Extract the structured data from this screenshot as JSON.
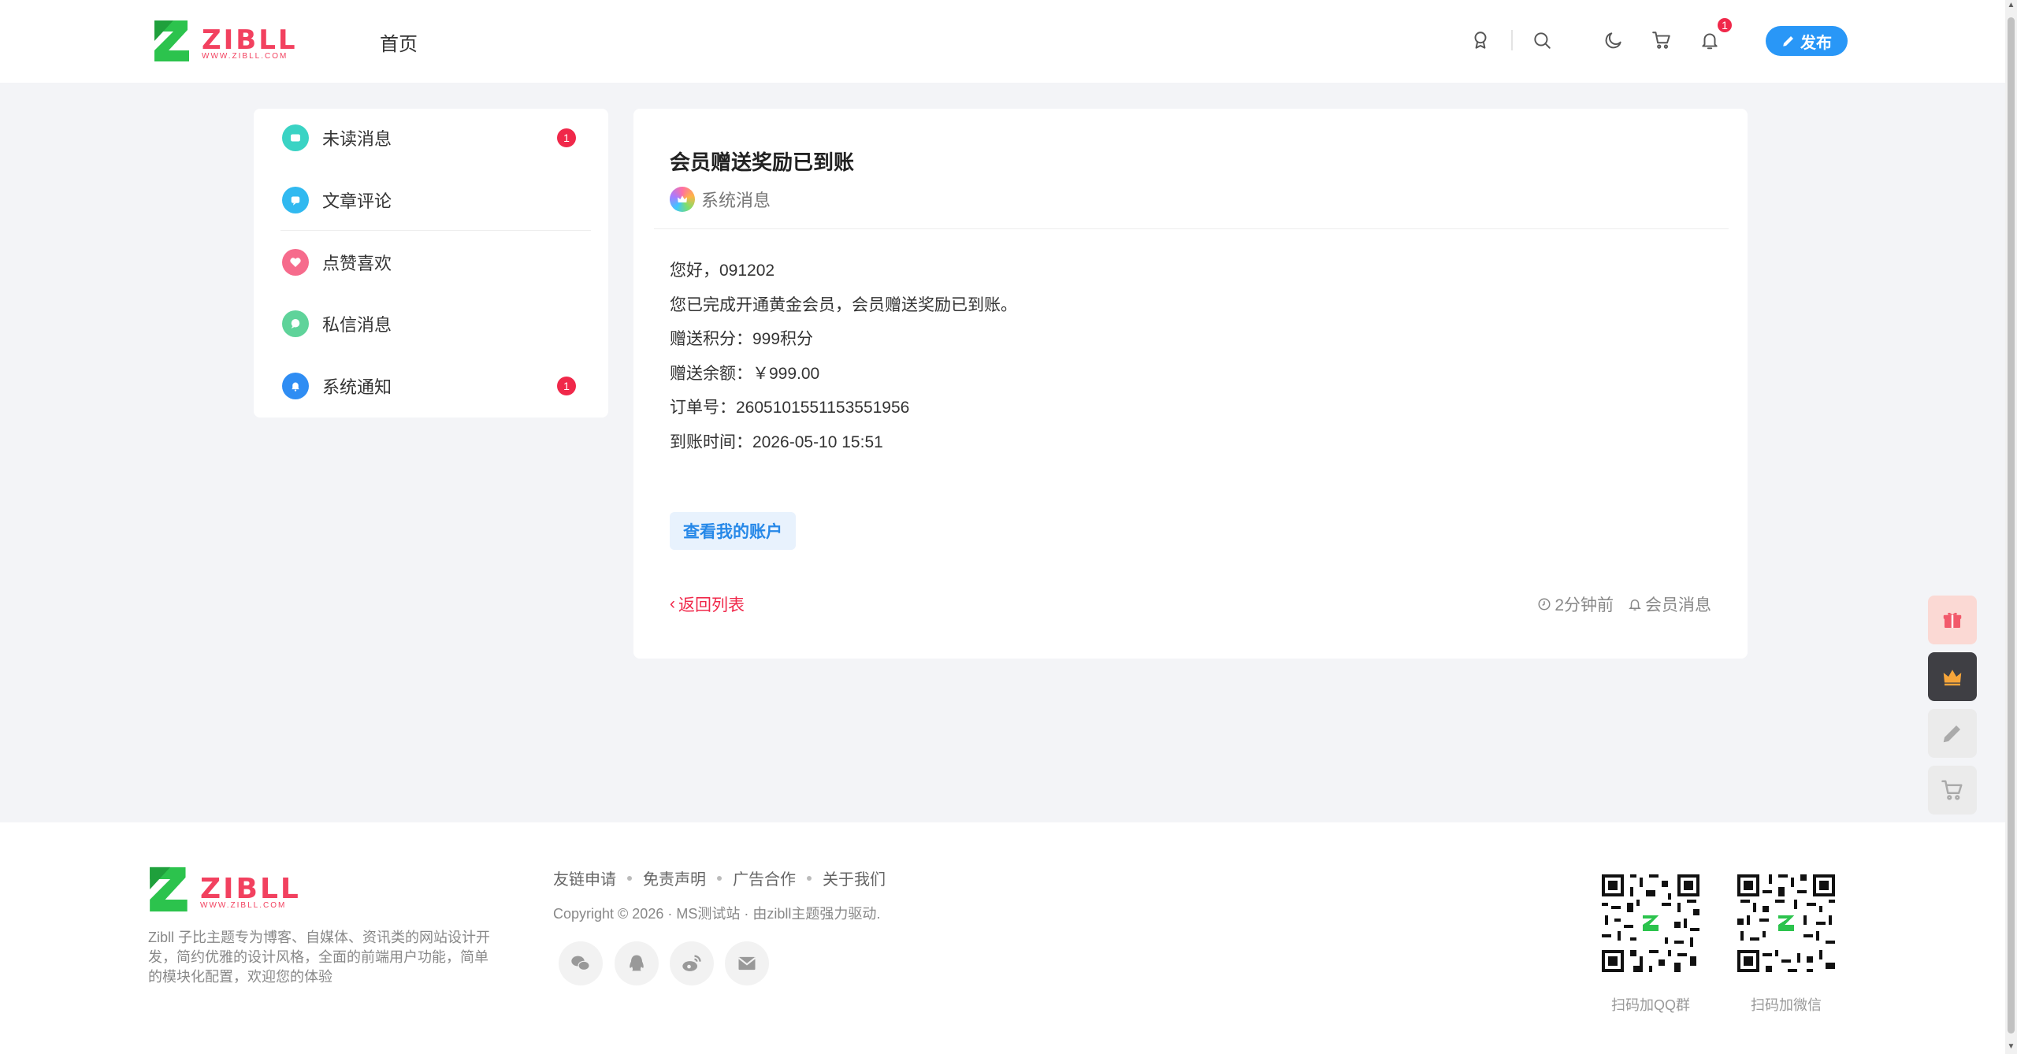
{
  "header": {
    "logo_text": "ZIBLL",
    "logo_sub": "WWW.ZIBLL.COM",
    "nav_home": "首页",
    "notification_count": "1",
    "publish_label": "发布"
  },
  "sidebar": {
    "items": [
      {
        "label": "未读消息",
        "badge": "1",
        "icon": "message-icon",
        "color": "#3ad3c4"
      },
      {
        "label": "文章评论",
        "icon": "comment-icon",
        "color": "#31b9f0"
      },
      {
        "label": "点赞喜欢",
        "icon": "heart-icon",
        "color": "#f66b8c"
      },
      {
        "label": "私信消息",
        "icon": "chat-bubble-icon",
        "color": "#5fd39a"
      },
      {
        "label": "系统通知",
        "badge": "1",
        "icon": "bell-icon",
        "color": "#2f8df3"
      }
    ]
  },
  "message": {
    "title": "会员赠送奖励已到账",
    "sender": "系统消息",
    "lines": [
      "您好，091202",
      "您已完成开通黄金会员，会员赠送奖励已到账。",
      "赠送积分：999积分",
      "赠送余额：￥999.00",
      "订单号：2605101551153551956",
      "到账时间：2026-05-10 15:51"
    ],
    "action_label": "查看我的账户",
    "back_label": "返回列表",
    "time_ago": "2分钟前",
    "category": "会员消息"
  },
  "float_buttons": [
    "gift-icon",
    "crown-icon",
    "pencil-icon",
    "cart-icon",
    "wechat-icon",
    "qrcode-icon"
  ],
  "footer": {
    "description": "Zibll 子比主题专为博客、自媒体、资讯类的网站设计开发，简约优雅的设计风格，全面的前端用户功能，简单的模块化配置，欢迎您的体验",
    "links": [
      "友链申请",
      "免责声明",
      "广告合作",
      "关于我们"
    ],
    "copyright": "Copyright © 2026 · MS测试站 · 由zibll主题强力驱动.",
    "qr_labels": [
      "扫码加QQ群",
      "扫码加微信"
    ]
  },
  "colors": {
    "accent_blue": "#2997f7",
    "badge_red": "#f0284a",
    "brand_green": "#2cc34d",
    "brand_red": "#f2415f"
  }
}
